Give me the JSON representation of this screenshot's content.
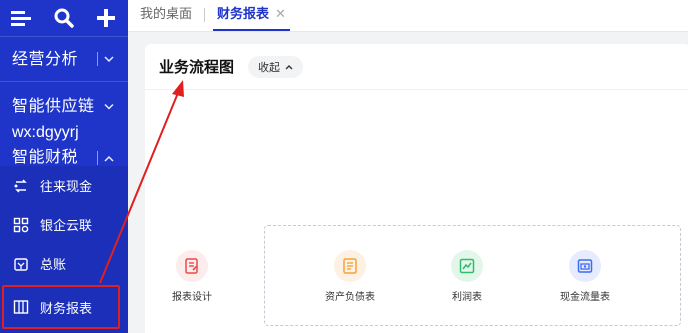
{
  "sidebar": {
    "top_icons": [
      "menu-icon",
      "search-icon",
      "plus-icon"
    ],
    "sections": [
      {
        "label": "经营分析",
        "expanded": false
      },
      {
        "label": "智能供应链",
        "expanded": false
      },
      {
        "label": "智能财税",
        "expanded": true
      }
    ],
    "overlay_text": "wx:dgyyrj",
    "items": [
      {
        "label": "往来现金",
        "icon": "cash-flow-icon"
      },
      {
        "label": "银企云联",
        "icon": "bank-link-icon"
      },
      {
        "label": "总账",
        "icon": "ledger-icon"
      },
      {
        "label": "财务报表",
        "icon": "report-book-icon",
        "active": true
      }
    ]
  },
  "tabs": [
    {
      "label": "我的桌面",
      "active": false
    },
    {
      "label": "财务报表",
      "active": true,
      "close": "✕"
    }
  ],
  "card": {
    "title": "业务流程图",
    "collapse_label": "收起"
  },
  "flow_nodes": [
    {
      "label": "报表设计",
      "icon": "report-design-icon",
      "color": "#f04848"
    },
    {
      "label": "资产负债表",
      "icon": "balance-sheet-icon",
      "color": "#f5a23a"
    },
    {
      "label": "利润表",
      "icon": "profit-chart-icon",
      "color": "#2ebd6b"
    },
    {
      "label": "现金流量表",
      "icon": "cash-flow-statement-icon",
      "color": "#3d6cf0"
    }
  ],
  "colors": {
    "sidebar": "#1f35c9",
    "accent": "#1f35c9",
    "annotation": "#e02020"
  }
}
